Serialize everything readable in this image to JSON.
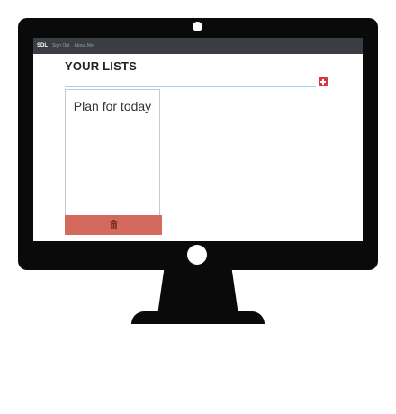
{
  "navbar": {
    "brand": "SDL",
    "links": [
      "Sign Out",
      "About Me"
    ]
  },
  "page": {
    "title": "YOUR LISTS",
    "add_icon": "plus-square-icon"
  },
  "lists": [
    {
      "title": "Plan for today",
      "delete_icon": "trash-icon"
    }
  ],
  "colors": {
    "navbar_bg": "#3a3d41",
    "add_button": "#d9363e",
    "delete_bar": "#d46a5e",
    "title_rule": "#9ad8e6",
    "bezel": "#0a0a0a"
  }
}
